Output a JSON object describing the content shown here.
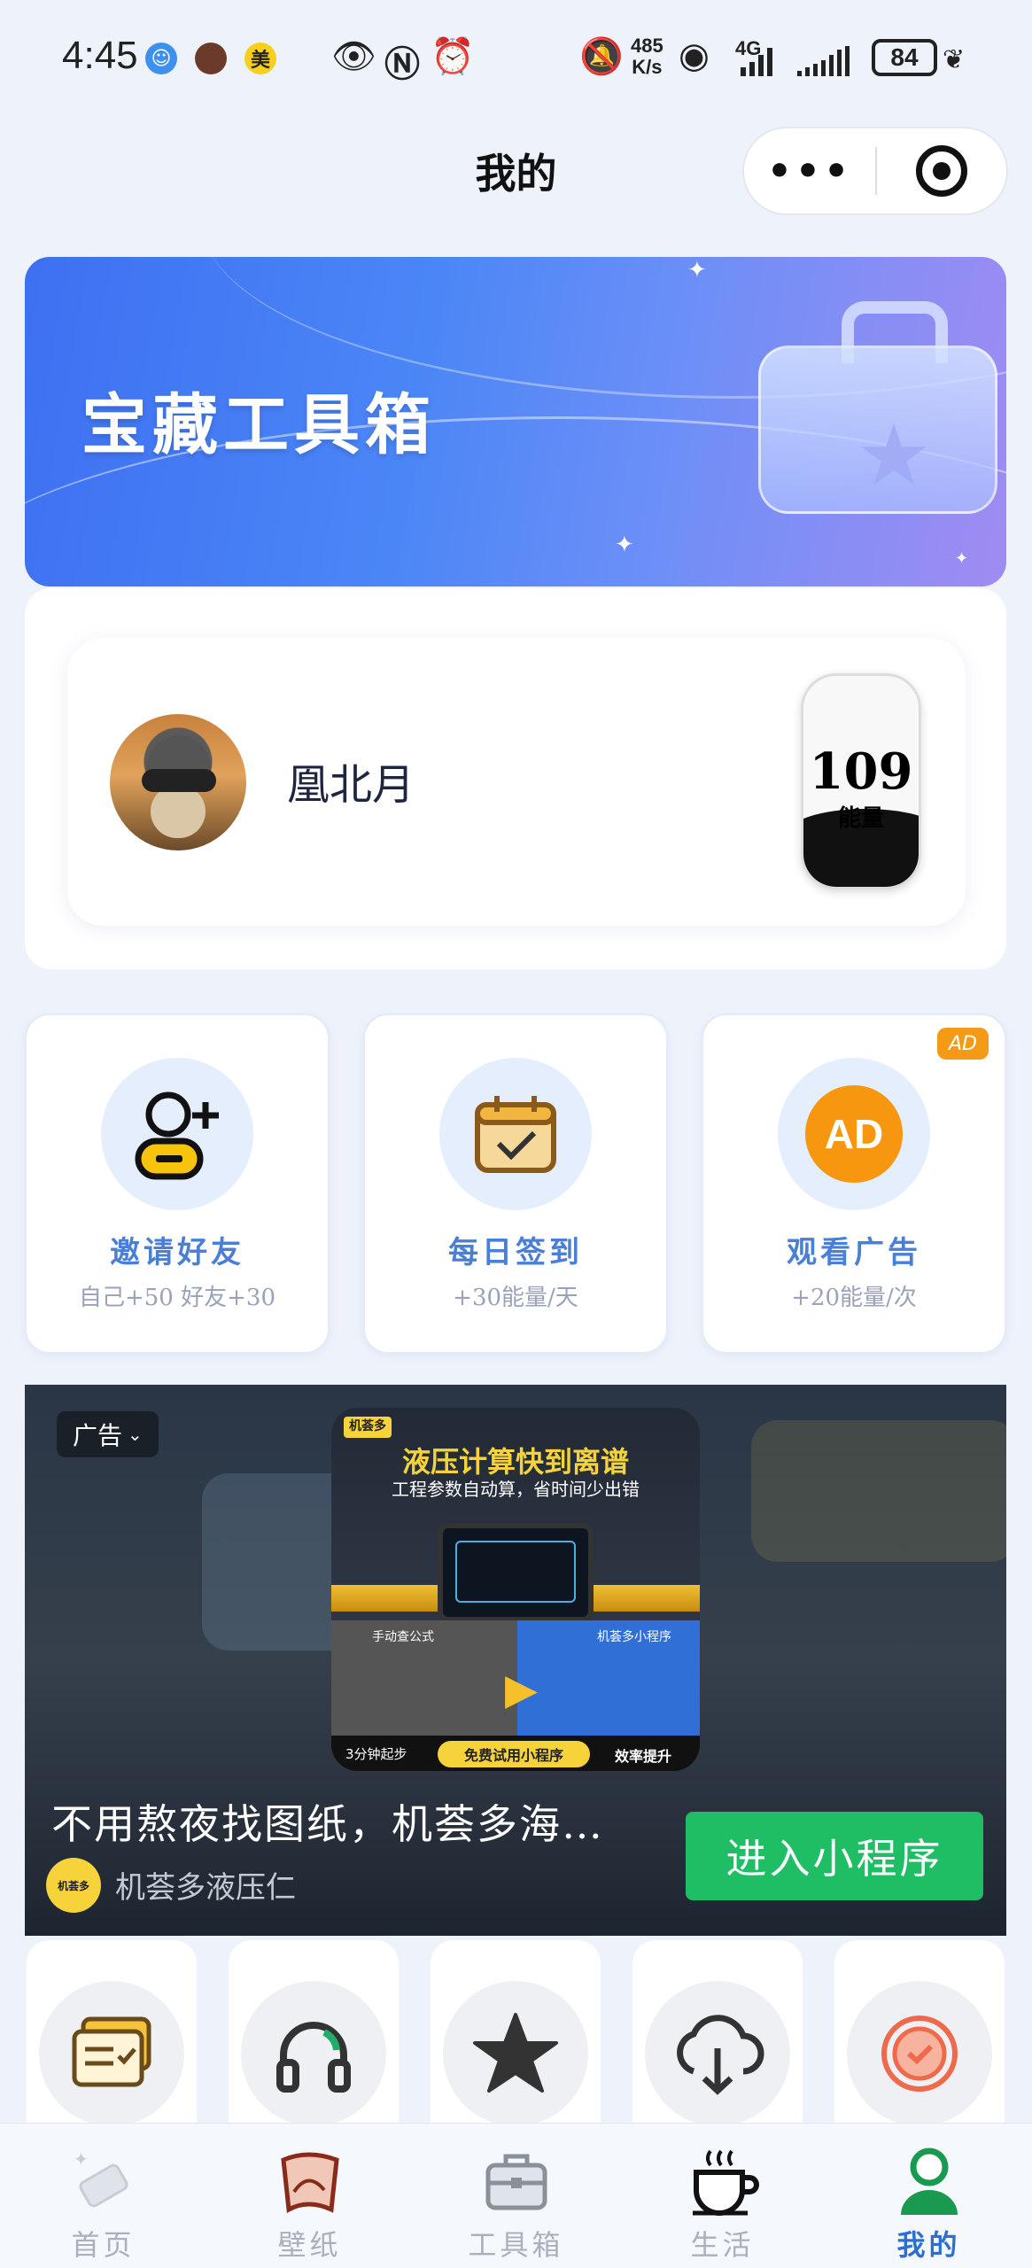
{
  "status_bar": {
    "time": "4:45",
    "app_badge_1": "",
    "app_badge_3": "美",
    "net_speed_value": "485",
    "net_speed_unit": "K/s",
    "network": "4G",
    "battery": "84"
  },
  "header": {
    "title": "我的",
    "more_label": "•••",
    "icons": [
      "more-icon",
      "target-icon"
    ]
  },
  "banner": {
    "title": "宝藏工具箱",
    "colors": {
      "start": "#3e70f2",
      "end": "#a08cf2"
    }
  },
  "profile": {
    "username": "凰北月",
    "energy_value": "109",
    "energy_label": "能量"
  },
  "tasks": [
    {
      "title": "邀请好友",
      "subtitle": "自己+50 好友+30",
      "icon": "add-friend-icon"
    },
    {
      "title": "每日签到",
      "subtitle": "+30能量/天",
      "icon": "calendar-check-icon"
    },
    {
      "title": "观看广告",
      "subtitle": "+20能量/次",
      "icon": "ad-icon",
      "badge": "AD",
      "icon_text": "AD"
    }
  ],
  "ad": {
    "tag": "广告",
    "poster": {
      "brand": "机荟多",
      "headline": "液压计算快到离谱",
      "subline": "工程参数自动算，省时间少出错",
      "panel_left": "手动查公式",
      "panel_right": "机荟多小程序",
      "bottom_left": "3分钟起步",
      "cta": "免费试用小程序",
      "bottom_right": "效率提升"
    },
    "headline": "不用熬夜找图纸，机荟多海…",
    "source_logo": "机荟多",
    "source": "机荟多液压仁",
    "cta": "进入小程序",
    "cta_color": "#1fbe64"
  },
  "grid_items": [
    {
      "icon": "task-list-icon"
    },
    {
      "icon": "headphones-icon"
    },
    {
      "icon": "star-icon"
    },
    {
      "icon": "cloud-download-icon"
    },
    {
      "icon": "badge-icon"
    }
  ],
  "tabbar": {
    "items": [
      {
        "label": "首页",
        "icon": "eraser-home-icon"
      },
      {
        "label": "壁纸",
        "icon": "wallpaper-icon"
      },
      {
        "label": "工具箱",
        "icon": "toolbox-icon"
      },
      {
        "label": "生活",
        "icon": "coffee-icon"
      },
      {
        "label": "我的",
        "icon": "profile-icon",
        "active": true
      }
    ],
    "active_color": "#2d6fd0"
  }
}
